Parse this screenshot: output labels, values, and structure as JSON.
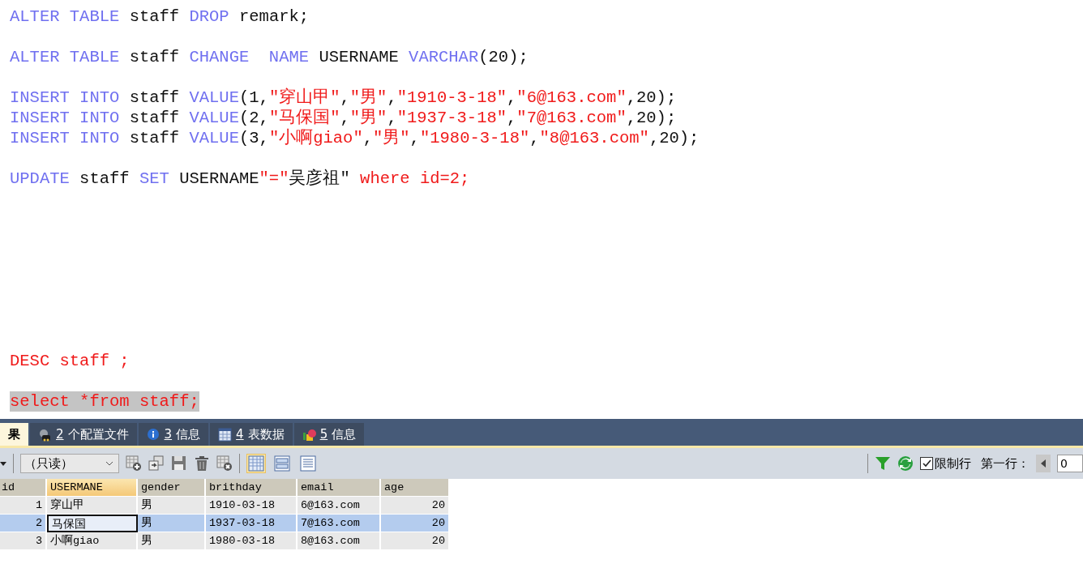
{
  "editor": {
    "lines": [
      {
        "kind": "code",
        "selected": false,
        "tokens": [
          {
            "kind": "kw",
            "text": "ALTER TABLE"
          },
          {
            "kind": "plain",
            "text": " staff "
          },
          {
            "kind": "kw",
            "text": "DROP"
          },
          {
            "kind": "plain",
            "text": " remark;"
          }
        ]
      },
      {
        "kind": "blank",
        "selected": false
      },
      {
        "kind": "code",
        "selected": false,
        "tokens": [
          {
            "kind": "kw",
            "text": "ALTER TABLE"
          },
          {
            "kind": "plain",
            "text": " staff "
          },
          {
            "kind": "kw",
            "text": "CHANGE  NAME"
          },
          {
            "kind": "plain",
            "text": " USERNAME "
          },
          {
            "kind": "kw",
            "text": "VARCHAR"
          },
          {
            "kind": "plain",
            "text": "(20);"
          }
        ]
      },
      {
        "kind": "blank",
        "selected": false
      },
      {
        "kind": "code",
        "selected": false,
        "tokens": [
          {
            "kind": "kw",
            "text": "INSERT INTO"
          },
          {
            "kind": "plain",
            "text": " staff "
          },
          {
            "kind": "kw",
            "text": "VALUE"
          },
          {
            "kind": "plain",
            "text": "(1,"
          },
          {
            "kind": "red",
            "text": "\"穿山甲\""
          },
          {
            "kind": "plain",
            "text": ","
          },
          {
            "kind": "red",
            "text": "\"男\""
          },
          {
            "kind": "plain",
            "text": ","
          },
          {
            "kind": "red",
            "text": "\"1910-3-18\""
          },
          {
            "kind": "plain",
            "text": ","
          },
          {
            "kind": "red",
            "text": "\"6@163.com\""
          },
          {
            "kind": "plain",
            "text": ",20);"
          }
        ]
      },
      {
        "kind": "code",
        "selected": false,
        "tokens": [
          {
            "kind": "kw",
            "text": "INSERT INTO"
          },
          {
            "kind": "plain",
            "text": " staff "
          },
          {
            "kind": "kw",
            "text": "VALUE"
          },
          {
            "kind": "plain",
            "text": "(2,"
          },
          {
            "kind": "red",
            "text": "\"马保国\""
          },
          {
            "kind": "plain",
            "text": ","
          },
          {
            "kind": "red",
            "text": "\"男\""
          },
          {
            "kind": "plain",
            "text": ","
          },
          {
            "kind": "red",
            "text": "\"1937-3-18\""
          },
          {
            "kind": "plain",
            "text": ","
          },
          {
            "kind": "red",
            "text": "\"7@163.com\""
          },
          {
            "kind": "plain",
            "text": ",20);"
          }
        ]
      },
      {
        "kind": "code",
        "selected": false,
        "tokens": [
          {
            "kind": "kw",
            "text": "INSERT INTO"
          },
          {
            "kind": "plain",
            "text": " staff "
          },
          {
            "kind": "kw",
            "text": "VALUE"
          },
          {
            "kind": "plain",
            "text": "(3,"
          },
          {
            "kind": "red",
            "text": "\"小啊giao\""
          },
          {
            "kind": "plain",
            "text": ","
          },
          {
            "kind": "red",
            "text": "\"男\""
          },
          {
            "kind": "plain",
            "text": ","
          },
          {
            "kind": "red",
            "text": "\"1980-3-18\""
          },
          {
            "kind": "plain",
            "text": ","
          },
          {
            "kind": "red",
            "text": "\"8@163.com\""
          },
          {
            "kind": "plain",
            "text": ",20);"
          }
        ]
      },
      {
        "kind": "blank",
        "selected": false
      },
      {
        "kind": "code",
        "selected": false,
        "tokens": [
          {
            "kind": "kw",
            "text": "UPDATE"
          },
          {
            "kind": "plain",
            "text": " staff "
          },
          {
            "kind": "kw",
            "text": "SET"
          },
          {
            "kind": "plain",
            "text": " USERNAME"
          },
          {
            "kind": "red",
            "text": "\"=\""
          },
          {
            "kind": "plain",
            "text": "吴彦祖\" "
          },
          {
            "kind": "red",
            "text": "where id=2;"
          }
        ]
      },
      {
        "kind": "blank",
        "selected": false
      },
      {
        "kind": "blank",
        "selected": false
      },
      {
        "kind": "blank",
        "selected": false
      },
      {
        "kind": "blank",
        "selected": false
      },
      {
        "kind": "blank",
        "selected": false
      },
      {
        "kind": "blank",
        "selected": false
      },
      {
        "kind": "blank",
        "selected": false
      },
      {
        "kind": "blank",
        "selected": false
      },
      {
        "kind": "code",
        "selected": false,
        "tokens": [
          {
            "kind": "red",
            "text": "DESC staff ;"
          }
        ]
      },
      {
        "kind": "blank",
        "selected": false
      },
      {
        "kind": "code",
        "selected": true,
        "tokens": [
          {
            "kind": "red",
            "text": "select *from staff;"
          }
        ]
      }
    ]
  },
  "result_tabs": [
    {
      "kind": "result",
      "label": "果",
      "selected": true
    },
    {
      "kind": "profile",
      "key": "2",
      "label": "个配置文件",
      "selected": false
    },
    {
      "kind": "info",
      "key": "3",
      "label": "信息",
      "selected": false
    },
    {
      "kind": "table",
      "key": "4",
      "label": "表数据",
      "selected": false
    },
    {
      "kind": "shapes",
      "key": "5",
      "label": "信息",
      "selected": false
    }
  ],
  "toolbar": {
    "mode": "（只读）",
    "views": [
      {
        "kind": "grid",
        "selected": true
      },
      {
        "kind": "form",
        "selected": false
      },
      {
        "kind": "text",
        "selected": false
      }
    ],
    "limit_rows": {
      "label": "限制行",
      "checked": true
    },
    "first_row_label": "第一行：",
    "first_row_value": "0"
  },
  "table": {
    "columns": [
      {
        "name": "id",
        "kind": "number",
        "selected": false
      },
      {
        "name": "USERMANE",
        "kind": "text",
        "selected": true
      },
      {
        "name": "gender",
        "kind": "text",
        "selected": false
      },
      {
        "name": "brithday",
        "kind": "text",
        "selected": false
      },
      {
        "name": "email",
        "kind": "text",
        "selected": false
      },
      {
        "name": "age",
        "kind": "number",
        "selected": false
      }
    ],
    "rows": [
      {
        "selected": false,
        "cells": [
          {
            "text": "1",
            "focused": false
          },
          {
            "text": "穿山甲",
            "focused": false
          },
          {
            "text": "男",
            "focused": false
          },
          {
            "text": "1910-03-18",
            "focused": false
          },
          {
            "text": "6@163.com",
            "focused": false
          },
          {
            "text": "20",
            "focused": false
          }
        ]
      },
      {
        "selected": true,
        "cells": [
          {
            "text": "2",
            "focused": false
          },
          {
            "text": "马保国",
            "focused": true
          },
          {
            "text": "男",
            "focused": false
          },
          {
            "text": "1937-03-18",
            "focused": false
          },
          {
            "text": "7@163.com",
            "focused": false
          },
          {
            "text": "20",
            "focused": false
          }
        ]
      },
      {
        "selected": false,
        "cells": [
          {
            "text": "3",
            "focused": false
          },
          {
            "text": "小啊giao",
            "focused": false
          },
          {
            "text": "男",
            "focused": false
          },
          {
            "text": "1980-03-18",
            "focused": false
          },
          {
            "text": "8@163.com",
            "focused": false
          },
          {
            "text": "20",
            "focused": false
          }
        ]
      }
    ]
  }
}
